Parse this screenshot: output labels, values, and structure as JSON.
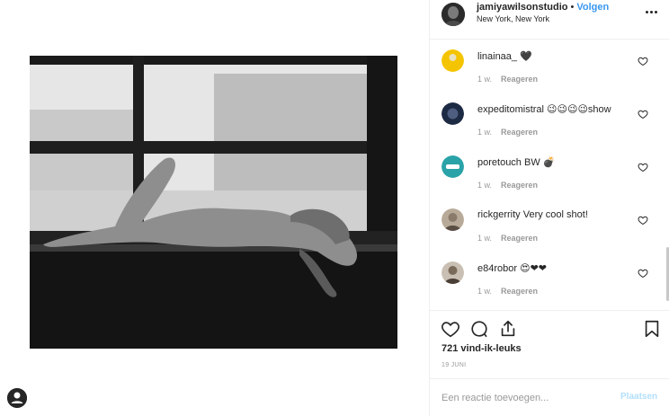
{
  "post": {
    "image_alt": "",
    "header": {
      "username": "jamiyawilsonstudio",
      "separator": "•",
      "follow_label": "Volgen",
      "location": "New York, New York"
    },
    "comments": [
      {
        "username": "linainaa_",
        "text": " 🖤",
        "time": "1 w.",
        "reply_label": "Reageren",
        "avatar_color": "#f5c400"
      },
      {
        "username": "expeditomistral",
        "text": " 😉😉😉😉show",
        "time": "1 w.",
        "reply_label": "Reageren",
        "avatar_color": "#1d2a44"
      },
      {
        "username": "poretouch",
        "text": " BW 💣",
        "time": "1 w.",
        "reply_label": "Reageren",
        "avatar_color": "#2aa3a8"
      },
      {
        "username": "rickgerrity",
        "text": " Very cool shot!",
        "time": "1 w.",
        "reply_label": "Reageren",
        "avatar_color": "#8a7a6a"
      },
      {
        "username": "e84robor",
        "text": " 😍❤❤",
        "time": "1 w.",
        "reply_label": "Reageren",
        "avatar_color": "#7a6a5a"
      }
    ],
    "likes": "721 vind-ik-leuks",
    "date": "19 JUNI",
    "add_comment": {
      "placeholder": "Een reactie toevoegen...",
      "post_label": "Plaatsen"
    }
  },
  "colors": {
    "link_blue": "#3897f0",
    "post_disabled": "#b2dffc",
    "muted_text": "#999999",
    "border": "#efefef"
  },
  "icons": {
    "like": "heart-icon",
    "comment": "comment-icon",
    "share": "share-icon",
    "save": "bookmark-icon",
    "more": "more-options-icon",
    "comment_like": "small-heart-icon"
  }
}
